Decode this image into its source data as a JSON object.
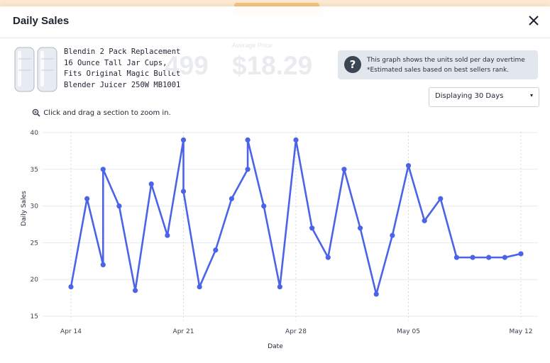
{
  "modal": {
    "title": "Daily Sales"
  },
  "product": {
    "name": "Blendin 2 Pack Replacement 16 Ounce Tall Jar Cups, Fits Original Magic Bullet Blender Juicer 250W MB1001"
  },
  "background_stats": {
    "rank_value": "499",
    "price_label": "Average Price",
    "price_value": "$18.29"
  },
  "info": {
    "icon": "question-bubble-icon",
    "line1": "This graph shows the units sold per day overtime",
    "line2": "*Estimated sales based on best sellers rank."
  },
  "range_select": {
    "selected": "Displaying 30 Days",
    "caret": "▾"
  },
  "zoom_hint": {
    "icon": "zoom-in-icon",
    "text": "Click and drag a section to zoom in."
  },
  "colors": {
    "series": "#4b63e6",
    "grid": "#e8eaee"
  },
  "chart_data": {
    "type": "line",
    "xlabel": "Date",
    "ylabel": "Daily Sales",
    "ylim": [
      15,
      40
    ],
    "yticks": [
      15,
      20,
      25,
      30,
      35,
      40
    ],
    "grid": "horizontal",
    "x_ticks": [
      "Apr 14",
      "Apr 21",
      "Apr 28",
      "May 05",
      "May 12"
    ],
    "series": [
      {
        "dates": [
          "Apr 14",
          "Apr 15",
          "Apr 16",
          "Apr 16",
          "Apr 17",
          "Apr 18",
          "Apr 19",
          "Apr 20",
          "Apr 21",
          "Apr 21",
          "Apr 22",
          "Apr 23",
          "Apr 24",
          "Apr 25",
          "Apr 25",
          "Apr 26",
          "Apr 27",
          "Apr 28",
          "Apr 29",
          "Apr 30",
          "May 01",
          "May 02",
          "May 03",
          "May 04",
          "May 05",
          "May 06",
          "May 07",
          "May 08",
          "May 09",
          "May 10",
          "May 11",
          "May 12"
        ],
        "values": [
          19,
          31,
          22,
          35,
          30,
          18.5,
          33,
          26,
          39,
          32,
          19,
          24,
          31,
          35,
          39,
          30,
          19,
          39,
          27,
          23,
          35,
          27,
          18,
          26,
          35.5,
          28,
          31,
          23,
          23,
          23,
          23,
          23.5
        ]
      }
    ]
  }
}
